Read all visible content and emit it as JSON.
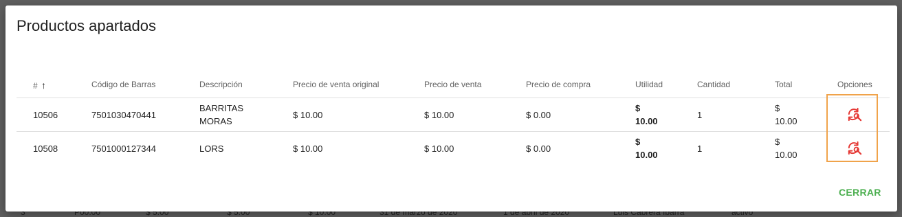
{
  "dialog": {
    "title": "Productos apartados",
    "close_label": "CERRAR"
  },
  "table": {
    "headers": {
      "id": "#",
      "sort_arrow": "↑",
      "barcode": "Código de Barras",
      "description": "Descripción",
      "orig_price": "Precio de venta original",
      "sale_price": "Precio de venta",
      "cost_price": "Precio de compra",
      "profit": "Utilidad",
      "quantity": "Cantidad",
      "total": "Total",
      "options": "Opciones"
    },
    "rows": [
      {
        "id": "10506",
        "barcode": "7501030470441",
        "description_l1": "BARRITAS",
        "description_l2": "MORAS",
        "orig_price": "$ 10.00",
        "sale_price": "$ 10.00",
        "cost_price": "$ 0.00",
        "profit_currency": "$",
        "profit_value": "10.00",
        "quantity": "1",
        "total_currency": "$",
        "total_value": "10.00"
      },
      {
        "id": "10508",
        "barcode": "7501000127344",
        "description_l1": "LORS",
        "orig_price": "$ 10.00",
        "sale_price": "$ 10.00",
        "cost_price": "$ 0.00",
        "profit_currency": "$",
        "profit_value": "10.00",
        "quantity": "1",
        "total_currency": "$",
        "total_value": "10.00"
      }
    ]
  },
  "colors": {
    "accent_green": "#4caf50",
    "icon_red": "#e53935",
    "highlight_orange": "#f0a34a"
  },
  "icons": {
    "row_option": "refresh-search-icon"
  }
}
